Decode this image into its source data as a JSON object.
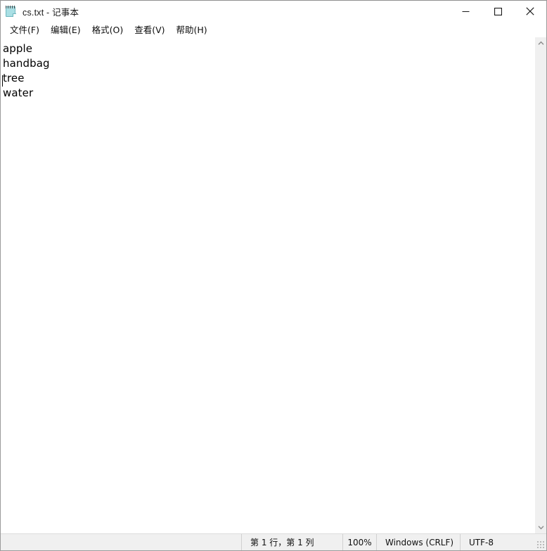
{
  "window": {
    "title": "cs.txt - 记事本",
    "icon": "notepad-icon",
    "controls": {
      "minimize_label": "最小化",
      "maximize_label": "最大化",
      "close_label": "关闭"
    }
  },
  "menubar": {
    "items": [
      {
        "label": "文件(F)",
        "name": "menu-file"
      },
      {
        "label": "编辑(E)",
        "name": "menu-edit"
      },
      {
        "label": "格式(O)",
        "name": "menu-format"
      },
      {
        "label": "查看(V)",
        "name": "menu-view"
      },
      {
        "label": "帮助(H)",
        "name": "menu-help"
      }
    ]
  },
  "editor": {
    "content": "apple\nhandbag\ntree\nwater",
    "lines": [
      "apple",
      "handbag",
      "tree",
      "water"
    ],
    "caret_line": 1,
    "caret_column": 1
  },
  "scrollbar": {
    "up_arrow": "chevron-up-icon",
    "down_arrow": "chevron-down-icon"
  },
  "statusbar": {
    "position": "第 1 行，第 1 列",
    "zoom": "100%",
    "line_ending": "Windows (CRLF)",
    "encoding": "UTF-8"
  },
  "colors": {
    "window_background": "#ffffff",
    "statusbar_background": "#f0f0f0",
    "text_color": "#000000",
    "border": "#9b9b9b",
    "icon_accent": "#a9dfe4"
  }
}
